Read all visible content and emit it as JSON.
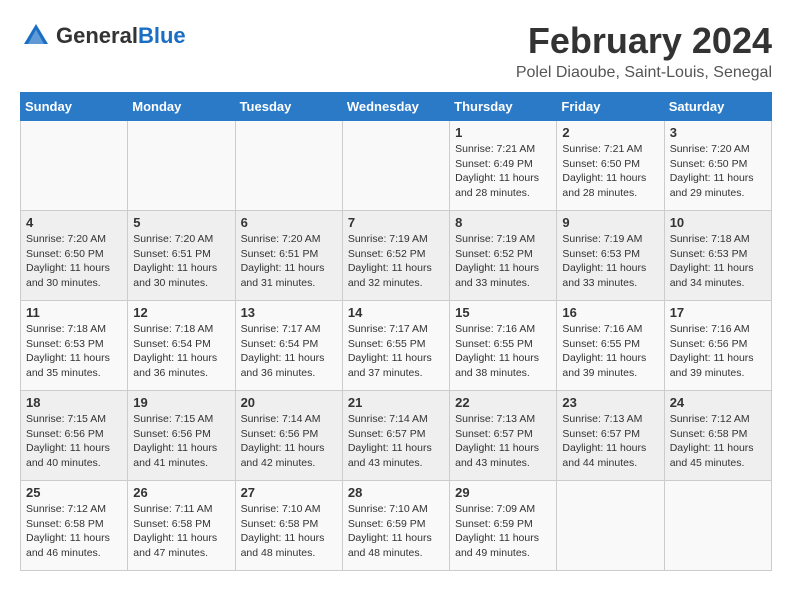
{
  "header": {
    "logo_general": "General",
    "logo_blue": "Blue",
    "month_title": "February 2024",
    "location": "Polel Diaoube, Saint-Louis, Senegal"
  },
  "days_of_week": [
    "Sunday",
    "Monday",
    "Tuesday",
    "Wednesday",
    "Thursday",
    "Friday",
    "Saturday"
  ],
  "weeks": [
    [
      {
        "day": "",
        "info": ""
      },
      {
        "day": "",
        "info": ""
      },
      {
        "day": "",
        "info": ""
      },
      {
        "day": "",
        "info": ""
      },
      {
        "day": "1",
        "info": "Sunrise: 7:21 AM\nSunset: 6:49 PM\nDaylight: 11 hours and 28 minutes."
      },
      {
        "day": "2",
        "info": "Sunrise: 7:21 AM\nSunset: 6:50 PM\nDaylight: 11 hours and 28 minutes."
      },
      {
        "day": "3",
        "info": "Sunrise: 7:20 AM\nSunset: 6:50 PM\nDaylight: 11 hours and 29 minutes."
      }
    ],
    [
      {
        "day": "4",
        "info": "Sunrise: 7:20 AM\nSunset: 6:50 PM\nDaylight: 11 hours and 30 minutes."
      },
      {
        "day": "5",
        "info": "Sunrise: 7:20 AM\nSunset: 6:51 PM\nDaylight: 11 hours and 30 minutes."
      },
      {
        "day": "6",
        "info": "Sunrise: 7:20 AM\nSunset: 6:51 PM\nDaylight: 11 hours and 31 minutes."
      },
      {
        "day": "7",
        "info": "Sunrise: 7:19 AM\nSunset: 6:52 PM\nDaylight: 11 hours and 32 minutes."
      },
      {
        "day": "8",
        "info": "Sunrise: 7:19 AM\nSunset: 6:52 PM\nDaylight: 11 hours and 33 minutes."
      },
      {
        "day": "9",
        "info": "Sunrise: 7:19 AM\nSunset: 6:53 PM\nDaylight: 11 hours and 33 minutes."
      },
      {
        "day": "10",
        "info": "Sunrise: 7:18 AM\nSunset: 6:53 PM\nDaylight: 11 hours and 34 minutes."
      }
    ],
    [
      {
        "day": "11",
        "info": "Sunrise: 7:18 AM\nSunset: 6:53 PM\nDaylight: 11 hours and 35 minutes."
      },
      {
        "day": "12",
        "info": "Sunrise: 7:18 AM\nSunset: 6:54 PM\nDaylight: 11 hours and 36 minutes."
      },
      {
        "day": "13",
        "info": "Sunrise: 7:17 AM\nSunset: 6:54 PM\nDaylight: 11 hours and 36 minutes."
      },
      {
        "day": "14",
        "info": "Sunrise: 7:17 AM\nSunset: 6:55 PM\nDaylight: 11 hours and 37 minutes."
      },
      {
        "day": "15",
        "info": "Sunrise: 7:16 AM\nSunset: 6:55 PM\nDaylight: 11 hours and 38 minutes."
      },
      {
        "day": "16",
        "info": "Sunrise: 7:16 AM\nSunset: 6:55 PM\nDaylight: 11 hours and 39 minutes."
      },
      {
        "day": "17",
        "info": "Sunrise: 7:16 AM\nSunset: 6:56 PM\nDaylight: 11 hours and 39 minutes."
      }
    ],
    [
      {
        "day": "18",
        "info": "Sunrise: 7:15 AM\nSunset: 6:56 PM\nDaylight: 11 hours and 40 minutes."
      },
      {
        "day": "19",
        "info": "Sunrise: 7:15 AM\nSunset: 6:56 PM\nDaylight: 11 hours and 41 minutes."
      },
      {
        "day": "20",
        "info": "Sunrise: 7:14 AM\nSunset: 6:56 PM\nDaylight: 11 hours and 42 minutes."
      },
      {
        "day": "21",
        "info": "Sunrise: 7:14 AM\nSunset: 6:57 PM\nDaylight: 11 hours and 43 minutes."
      },
      {
        "day": "22",
        "info": "Sunrise: 7:13 AM\nSunset: 6:57 PM\nDaylight: 11 hours and 43 minutes."
      },
      {
        "day": "23",
        "info": "Sunrise: 7:13 AM\nSunset: 6:57 PM\nDaylight: 11 hours and 44 minutes."
      },
      {
        "day": "24",
        "info": "Sunrise: 7:12 AM\nSunset: 6:58 PM\nDaylight: 11 hours and 45 minutes."
      }
    ],
    [
      {
        "day": "25",
        "info": "Sunrise: 7:12 AM\nSunset: 6:58 PM\nDaylight: 11 hours and 46 minutes."
      },
      {
        "day": "26",
        "info": "Sunrise: 7:11 AM\nSunset: 6:58 PM\nDaylight: 11 hours and 47 minutes."
      },
      {
        "day": "27",
        "info": "Sunrise: 7:10 AM\nSunset: 6:58 PM\nDaylight: 11 hours and 48 minutes."
      },
      {
        "day": "28",
        "info": "Sunrise: 7:10 AM\nSunset: 6:59 PM\nDaylight: 11 hours and 48 minutes."
      },
      {
        "day": "29",
        "info": "Sunrise: 7:09 AM\nSunset: 6:59 PM\nDaylight: 11 hours and 49 minutes."
      },
      {
        "day": "",
        "info": ""
      },
      {
        "day": "",
        "info": ""
      }
    ]
  ]
}
